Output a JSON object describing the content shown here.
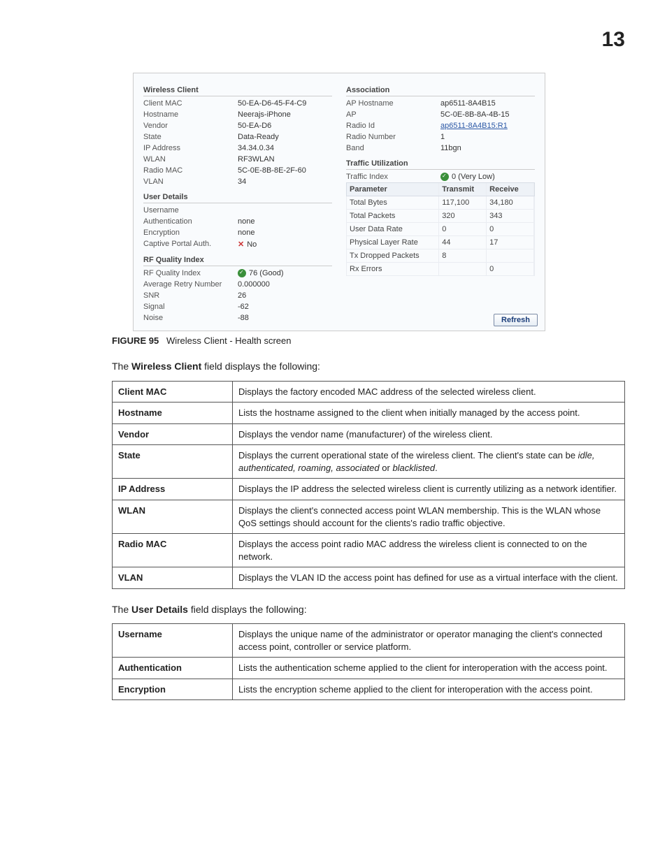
{
  "chapterNumber": "13",
  "screenshot": {
    "left": {
      "wirelessClient": {
        "title": "Wireless Client",
        "rows": [
          {
            "k": "Client MAC",
            "v": "50-EA-D6-45-F4-C9"
          },
          {
            "k": "Hostname",
            "v": "Neerajs-iPhone"
          },
          {
            "k": "Vendor",
            "v": "50-EA-D6"
          },
          {
            "k": "State",
            "v": "Data-Ready"
          },
          {
            "k": "IP Address",
            "v": "34.34.0.34"
          },
          {
            "k": "WLAN",
            "v": "RF3WLAN"
          },
          {
            "k": "Radio MAC",
            "v": "5C-0E-8B-8E-2F-60"
          },
          {
            "k": "VLAN",
            "v": "34"
          }
        ]
      },
      "userDetails": {
        "title": "User Details",
        "rows": [
          {
            "k": "Username",
            "v": ""
          },
          {
            "k": "Authentication",
            "v": "none"
          },
          {
            "k": "Encryption",
            "v": "none"
          },
          {
            "k": "Captive Portal Auth.",
            "v": "No",
            "x": true
          }
        ]
      },
      "rfQuality": {
        "title": "RF Quality Index",
        "rows": [
          {
            "k": "RF Quality Index",
            "v": "76 (Good)",
            "dot": true
          },
          {
            "k": "Average Retry Number",
            "v": "0.000000"
          },
          {
            "k": "SNR",
            "v": "26"
          },
          {
            "k": "Signal",
            "v": "-62"
          },
          {
            "k": "Noise",
            "v": "-88"
          }
        ]
      }
    },
    "right": {
      "association": {
        "title": "Association",
        "rows": [
          {
            "k": "AP Hostname",
            "v": "ap6511-8A4B15"
          },
          {
            "k": "AP",
            "v": "5C-0E-8B-8A-4B-15"
          },
          {
            "k": "Radio Id",
            "v": "ap6511-8A4B15:R1",
            "link": true
          },
          {
            "k": "Radio Number",
            "v": "1"
          },
          {
            "k": "Band",
            "v": "11bgn"
          }
        ]
      },
      "traffic": {
        "title": "Traffic Utilization",
        "indexLabel": "Traffic Index",
        "indexValue": "0 (Very Low)",
        "head": {
          "p": "Parameter",
          "t": "Transmit",
          "r": "Receive"
        },
        "rows": [
          {
            "p": "Total Bytes",
            "t": "117,100",
            "r": "34,180"
          },
          {
            "p": "Total Packets",
            "t": "320",
            "r": "343"
          },
          {
            "p": "User Data Rate",
            "t": "0",
            "r": "0"
          },
          {
            "p": "Physical Layer Rate",
            "t": "44",
            "r": "17"
          },
          {
            "p": "Tx Dropped Packets",
            "t": "8",
            "r": ""
          },
          {
            "p": "Rx Errors",
            "t": "",
            "r": "0"
          }
        ]
      }
    },
    "refresh": "Refresh"
  },
  "figure": {
    "num": "FIGURE 95",
    "cap": "Wireless Client - Health screen"
  },
  "intro1a": "The ",
  "intro1b": "Wireless Client",
  "intro1c": " field displays the following:",
  "table1": [
    {
      "k": "Client MAC",
      "v": "Displays the factory encoded MAC address of the selected wireless client."
    },
    {
      "k": "Hostname",
      "v": "Lists the hostname assigned to the client when initially managed by the access point."
    },
    {
      "k": "Vendor",
      "v": "Displays the vendor name (manufacturer) of the wireless client."
    },
    {
      "k": "State",
      "pre": "Displays the current operational state of the wireless client. The client's state can be ",
      "it": "idle, authenticated, roaming, associated",
      "post": " or ",
      "it2": "blacklisted",
      "post2": "."
    },
    {
      "k": "IP Address",
      "v": "Displays the IP address the selected wireless client is currently utilizing as a network identifier."
    },
    {
      "k": "WLAN",
      "v": "Displays the client's connected access point WLAN membership. This is the WLAN whose QoS settings should account for the clients's radio traffic objective."
    },
    {
      "k": "Radio MAC",
      "v": "Displays the access point radio MAC address the wireless client is connected to on the network."
    },
    {
      "k": "VLAN",
      "v": "Displays the VLAN ID the access point has defined for use as a virtual interface with the client."
    }
  ],
  "intro2a": "The ",
  "intro2b": "User Details",
  "intro2c": " field displays the following:",
  "table2": [
    {
      "k": "Username",
      "v": "Displays the unique name of the administrator or operator managing the client's connected access point, controller or service platform."
    },
    {
      "k": "Authentication",
      "v": "Lists the authentication scheme applied to the client for interoperation with the access point."
    },
    {
      "k": "Encryption",
      "v": "Lists the encryption scheme applied to the client for interoperation with the access point."
    }
  ]
}
